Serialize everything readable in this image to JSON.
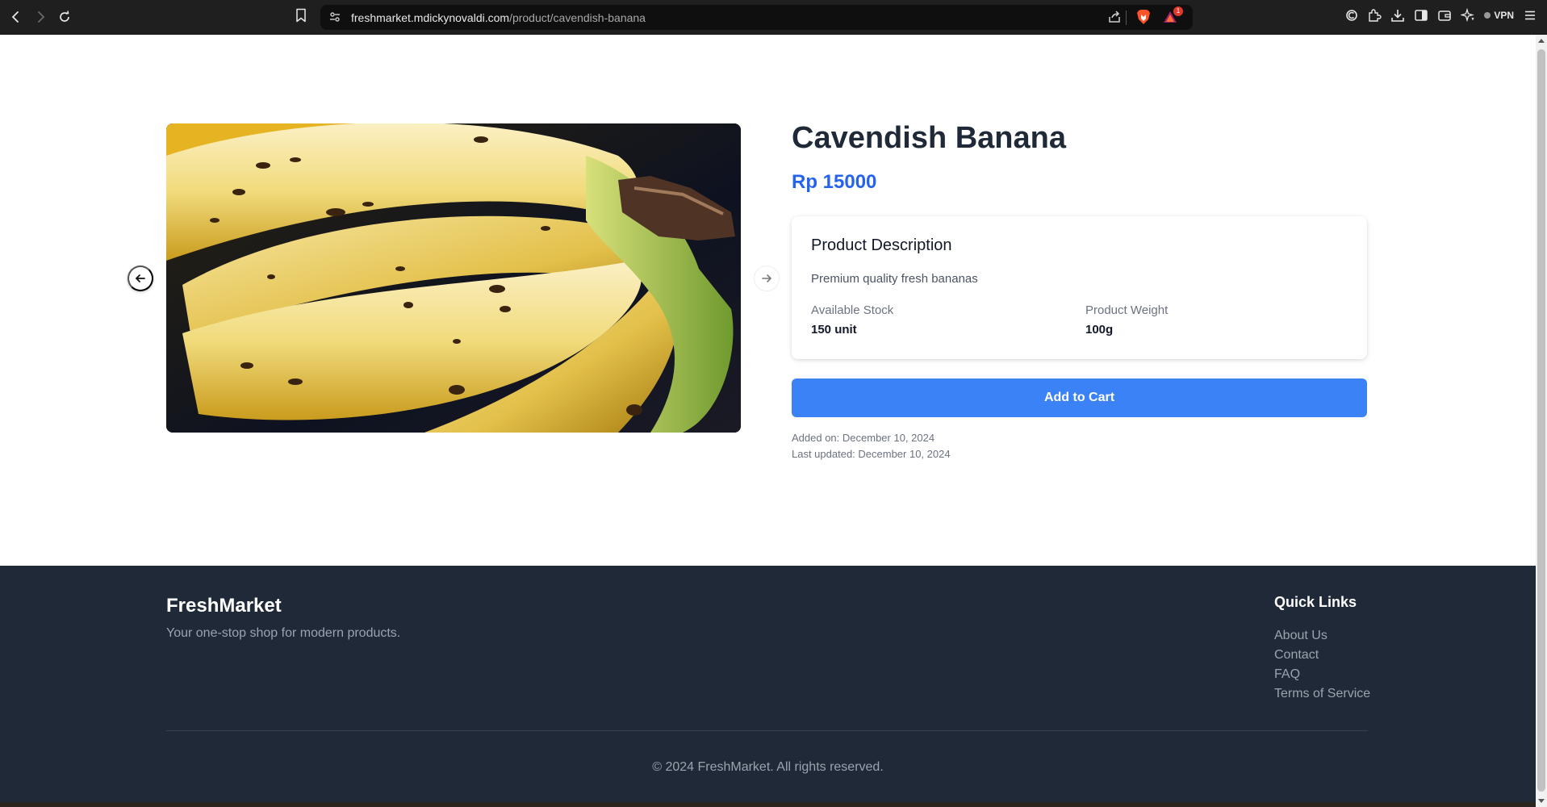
{
  "browser": {
    "url_host": "freshmarket.mdickynovaldi.com",
    "url_path": "/product/cavendish-banana",
    "rewards_badge": "1",
    "vpn_label": "VPN"
  },
  "product": {
    "name": "Cavendish Banana",
    "price": "Rp 15000",
    "description_title": "Product Description",
    "description": "Premium quality fresh bananas",
    "stock_label": "Available Stock",
    "stock_value": "150 unit",
    "weight_label": "Product Weight",
    "weight_value": "100g",
    "add_to_cart": "Add to Cart",
    "added_on": "Added on: December 10, 2024",
    "last_updated": "Last updated: December 10, 2024"
  },
  "footer": {
    "brand": "FreshMarket",
    "tagline": "Your one-stop shop for modern products.",
    "quick_links_title": "Quick Links",
    "links": [
      "About Us",
      "Contact",
      "FAQ",
      "Terms of Service"
    ],
    "copyright": "© 2024 FreshMarket. All rights reserved."
  },
  "colors": {
    "accent": "#3b82f6",
    "price": "#2563eb",
    "footer_bg": "#1f2937",
    "chrome_bg": "#1f1f1f"
  },
  "icons": [
    "back-icon",
    "forward-icon",
    "reload-icon",
    "bookmark-icon",
    "site-settings-icon",
    "share-icon",
    "brave-shield-icon",
    "rewards-icon",
    "leo-icon",
    "extensions-icon",
    "downloads-icon",
    "sidebar-icon",
    "wallet-icon",
    "ai-icon",
    "menu-icon",
    "arrow-left-icon",
    "arrow-right-icon"
  ]
}
